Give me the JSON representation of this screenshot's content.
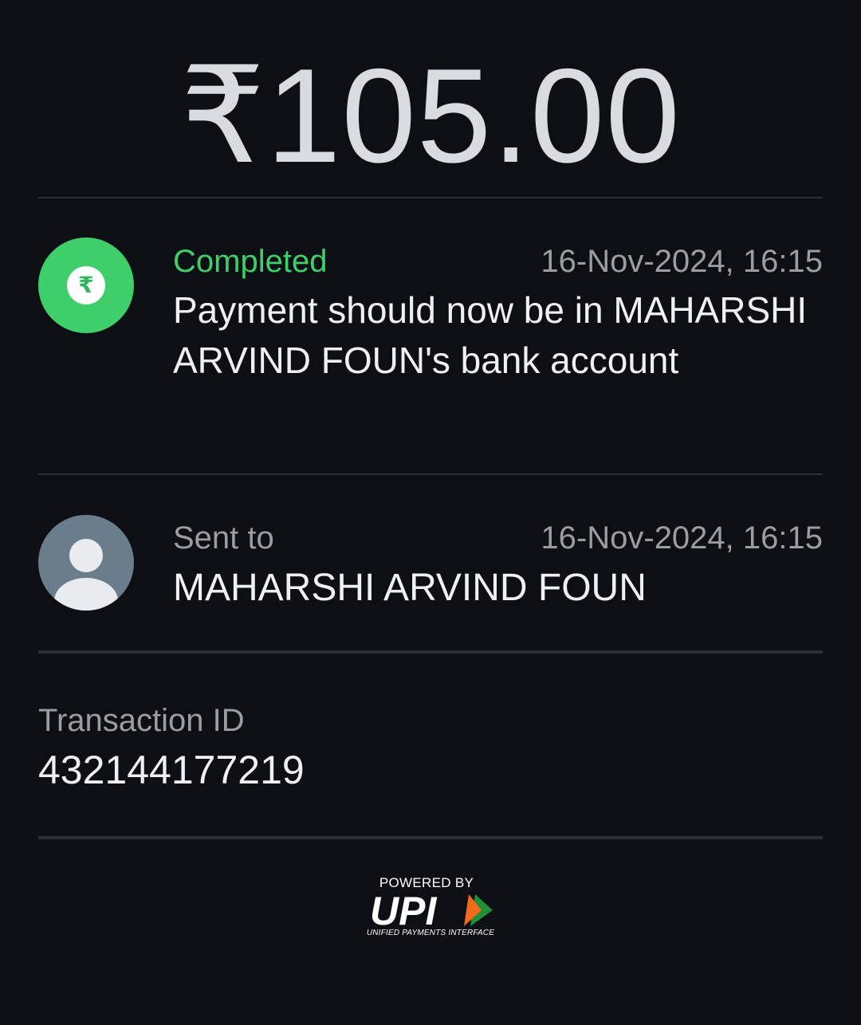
{
  "amount": "₹105.00",
  "status": {
    "icon": "rupee-icon",
    "label": "Completed",
    "datetime": "16-Nov-2024, 16:15",
    "message": "Payment should now be in MAHARSHI ARVIND FOUN's bank account",
    "color": "#3ecf6a"
  },
  "recipient": {
    "icon": "person-avatar-icon",
    "label": "Sent to",
    "datetime": "16-Nov-2024, 16:15",
    "name": "MAHARSHI ARVIND FOUN"
  },
  "transaction": {
    "label": "Transaction ID",
    "id": "432144177219"
  },
  "footer": {
    "powered_by": "POWERED BY",
    "logo_text": "UPI",
    "tagline": "UNIFIED PAYMENTS INTERFACE"
  }
}
